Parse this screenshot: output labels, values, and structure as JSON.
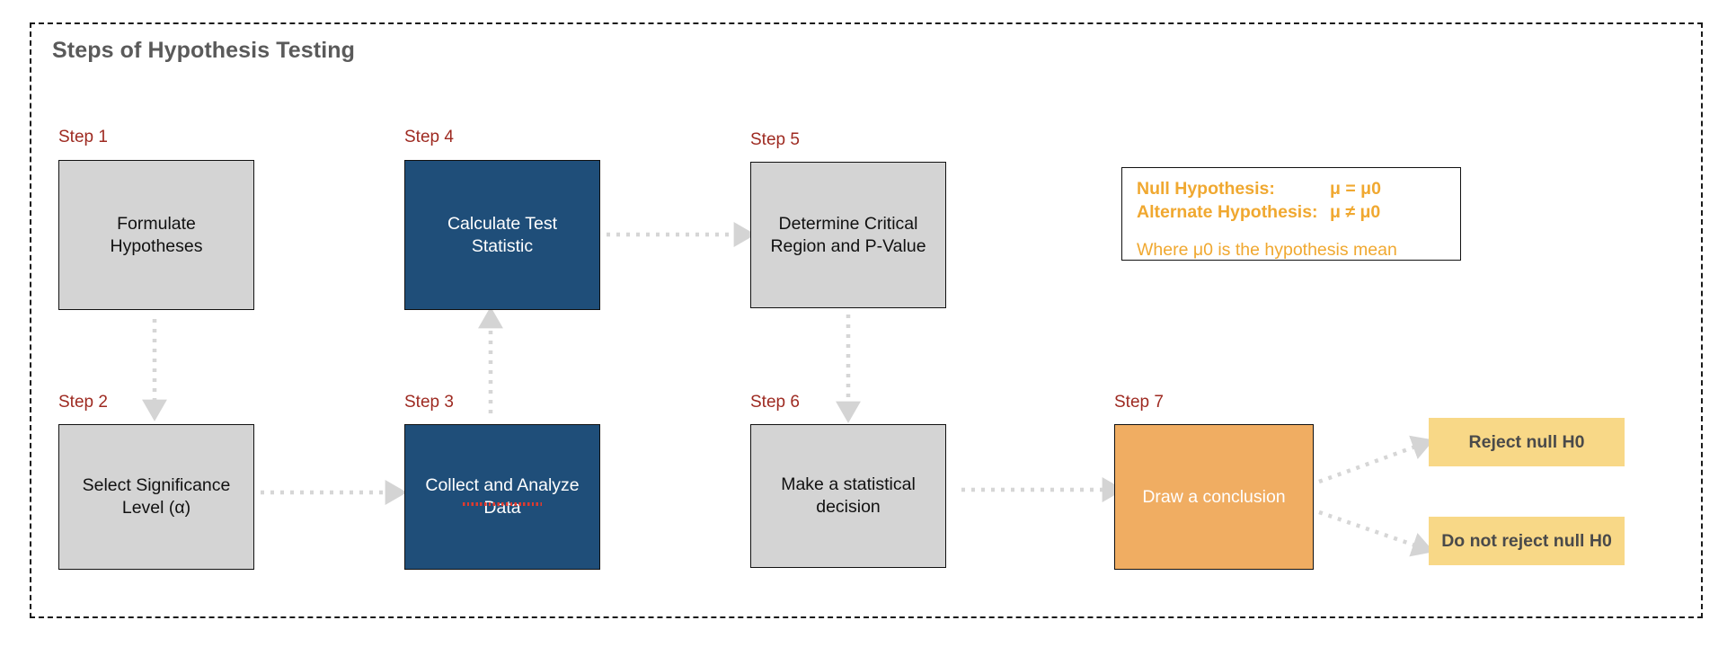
{
  "diagram": {
    "title": "Steps of Hypothesis Testing",
    "colors": {
      "step_label": "#9e2a21",
      "title": "#5a5a5a",
      "grey_box": "#d4d4d4",
      "blue_box": "#1f4e79",
      "orange_box": "#f0ad62",
      "outcome_box": "#f8d887",
      "accent_amber": "#f0a830",
      "connector": "#d4d4d4",
      "frame_border": "#1a1a1a"
    },
    "steps": [
      {
        "label": "Step 1",
        "text": "Formulate Hypotheses",
        "style": "grey"
      },
      {
        "label": "Step 2",
        "text": "Select Significance Level (α)",
        "style": "grey"
      },
      {
        "label": "Step 3",
        "text": "Collect and Analyze Data",
        "style": "blue"
      },
      {
        "label": "Step 4",
        "text": "Calculate Test Statistic",
        "style": "blue"
      },
      {
        "label": "Step 5",
        "text": "Determine Critical Region and P-Value",
        "style": "grey"
      },
      {
        "label": "Step 6",
        "text": "Make a statistical decision",
        "style": "grey"
      },
      {
        "label": "Step 7",
        "text": "Draw a conclusion",
        "style": "orange"
      }
    ],
    "outcomes": [
      {
        "text": "Reject null H0"
      },
      {
        "text": "Do not reject null H0"
      }
    ],
    "hypothesis_panel": {
      "null_label": "Null Hypothesis:",
      "null_value": "μ = μ0",
      "alternate_label": "Alternate Hypothesis:",
      "alternate_value": "μ ≠ μ0",
      "note": "Where μ0 is the hypothesis mean"
    }
  }
}
